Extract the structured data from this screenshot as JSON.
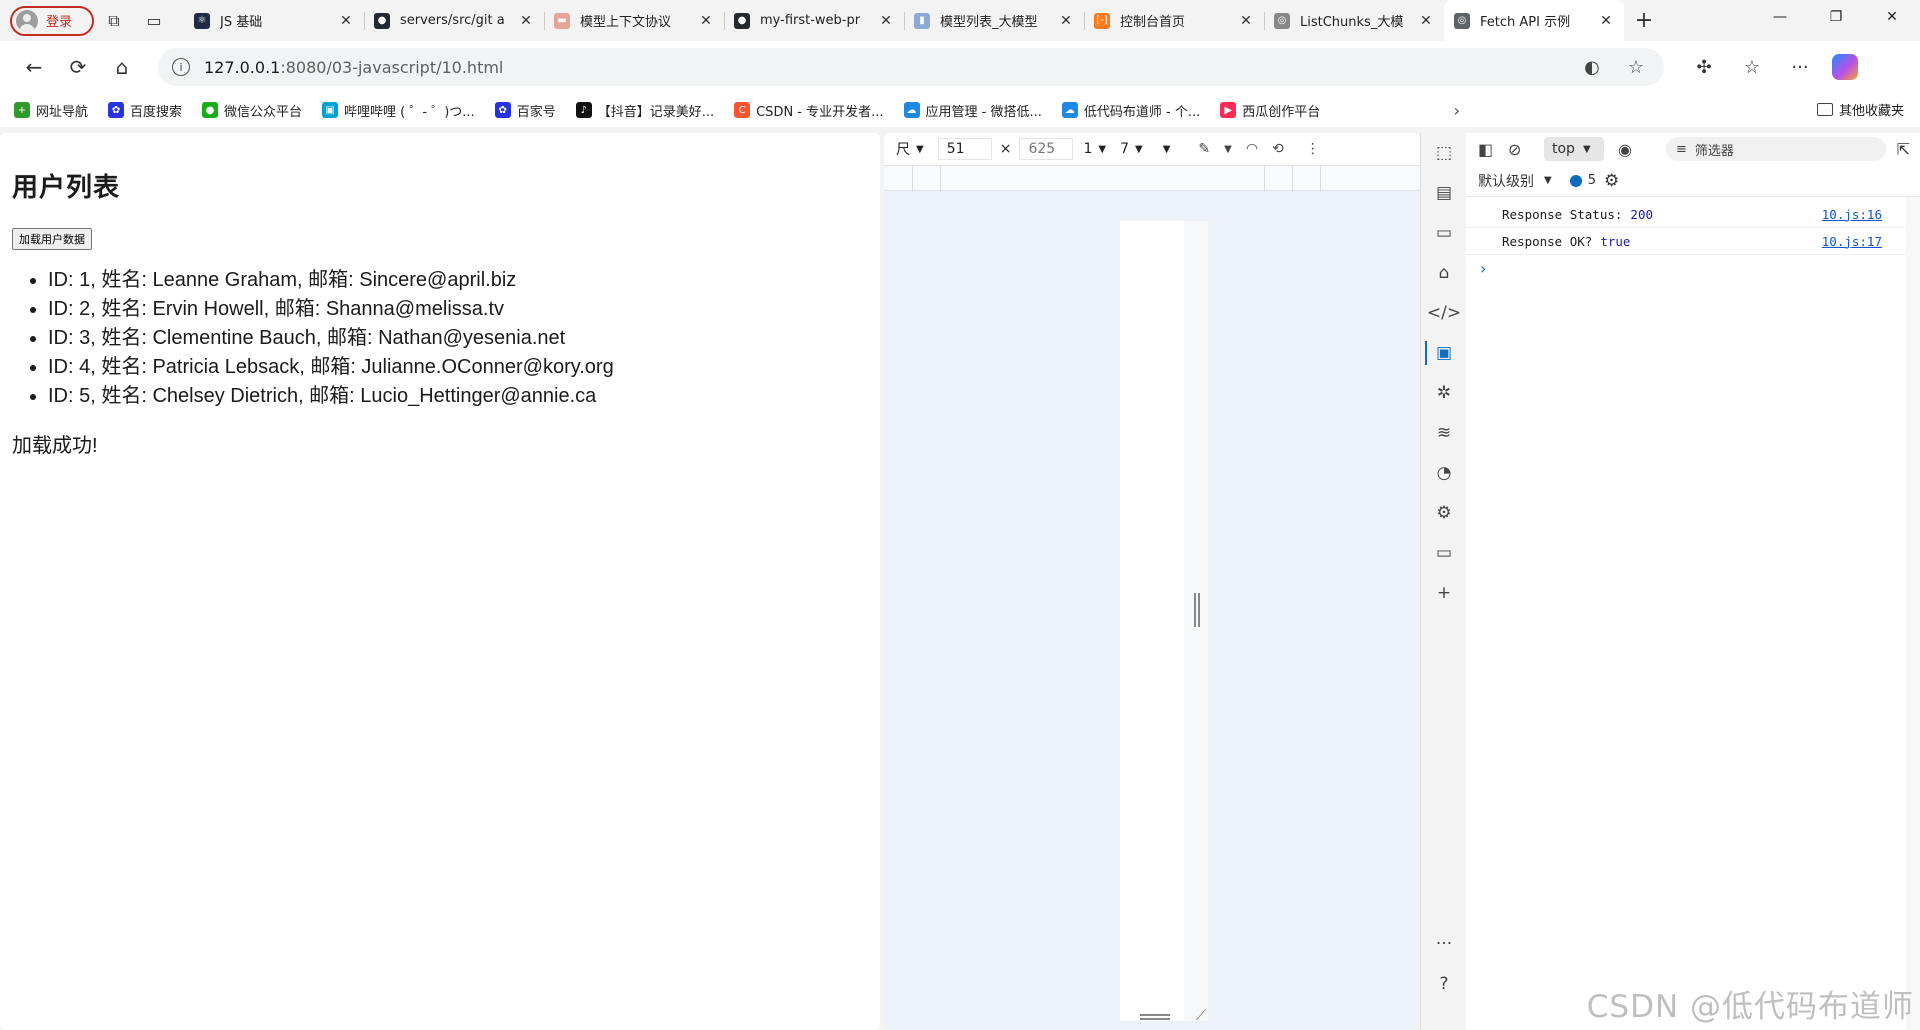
{
  "profile": {
    "label": "登录"
  },
  "tabs": [
    {
      "title": "JS 基础",
      "favicon_color": "#1f2a44",
      "favicon_glyph": "⚛"
    },
    {
      "title": "servers/src/git a",
      "favicon_color": "#24292f",
      "favicon_glyph": "●"
    },
    {
      "title": "模型上下文协议",
      "favicon_color": "#e8a398",
      "favicon_glyph": "▬"
    },
    {
      "title": "my-first-web-pr",
      "favicon_color": "#24292f",
      "favicon_glyph": "●"
    },
    {
      "title": "模型列表_大模型",
      "favicon_color": "#8ea8d8",
      "favicon_glyph": "▮"
    },
    {
      "title": "控制台首页",
      "favicon_color": "#ff7a1a",
      "favicon_glyph": "[-]"
    },
    {
      "title": "ListChunks_大模",
      "favicon_color": "#888888",
      "favicon_glyph": "◎"
    },
    {
      "title": "Fetch API 示例",
      "favicon_color": "#5f6368",
      "favicon_glyph": "◎",
      "active": true
    }
  ],
  "address": {
    "host": "127.0.0.1",
    "rest": ":8080/03-javascript/10.html"
  },
  "bookmarks": [
    {
      "label": "网址导航",
      "color": "#2e9a2e",
      "glyph": "+"
    },
    {
      "label": "百度搜索",
      "color": "#2932e1",
      "glyph": "✿"
    },
    {
      "label": "微信公众平台",
      "color": "#1aad19",
      "glyph": "●"
    },
    {
      "label": "哔哩哔哩 ( ゜- ゜)つ...",
      "color": "#00a1d6",
      "glyph": "▣"
    },
    {
      "label": "百家号",
      "color": "#2932e1",
      "glyph": "✿"
    },
    {
      "label": "【抖音】记录美好...",
      "color": "#111111",
      "glyph": "♪"
    },
    {
      "label": "CSDN - 专业开发者...",
      "color": "#fc5531",
      "glyph": "C"
    },
    {
      "label": "应用管理 - 微搭低...",
      "color": "#1e88e5",
      "glyph": "☁"
    },
    {
      "label": "低代码布道师 - 个...",
      "color": "#1e88e5",
      "glyph": "☁"
    },
    {
      "label": "西瓜创作平台",
      "color": "#fe2c55",
      "glyph": "▶"
    }
  ],
  "bookmarks_other": "其他收藏夹",
  "page": {
    "heading": "用户列表",
    "load_button": "加载用户数据",
    "users": [
      "ID: 1, 姓名: Leanne Graham, 邮箱: Sincere@april.biz",
      "ID: 2, 姓名: Ervin Howell, 邮箱: Shanna@melissa.tv",
      "ID: 3, 姓名: Clementine Bauch, 邮箱: Nathan@yesenia.net",
      "ID: 4, 姓名: Patricia Lebsack, 邮箱: Julianne.OConner@kory.org",
      "ID: 5, 姓名: Chelsey Dietrich, 邮箱: Lucio_Hettinger@annie.ca"
    ],
    "status": "加载成功!"
  },
  "emulation": {
    "device_label": "尺",
    "width": "51",
    "height": "625",
    "dpr": "1",
    "zoom": "7"
  },
  "console": {
    "context": "top",
    "filter_placeholder": "筛选器",
    "level": "默认级别",
    "message_count": "5",
    "logs": [
      {
        "text": "Response Status:",
        "value": "200",
        "source": "10.js:16"
      },
      {
        "text": "Response OK?",
        "value": "true",
        "source": "10.js:17"
      }
    ]
  },
  "watermark": "CSDN @低代码布道师"
}
